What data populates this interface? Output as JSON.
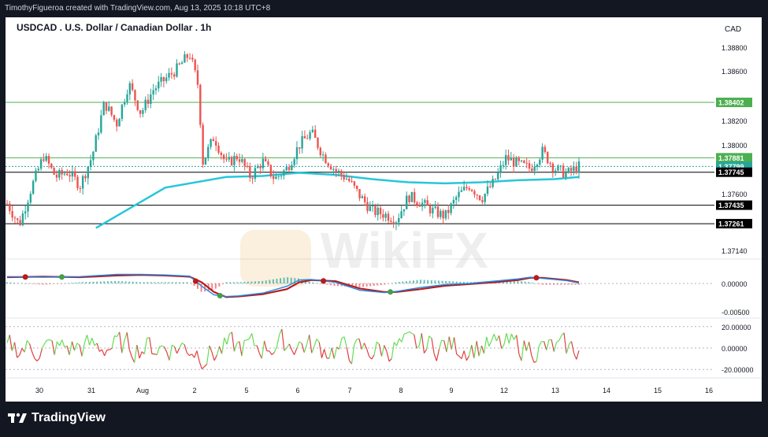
{
  "header": {
    "credit": "TimothyFigueroa created with TradingView.com, Aug 13, 2025 10:18 UTC+8"
  },
  "footer": {
    "brand": "TradingView"
  },
  "watermark": "WikiFX",
  "colors": {
    "up": "#26a69a",
    "down": "#ef5350",
    "ma": "#26c6da",
    "macd_fast": "#1e88e5",
    "macd_slow": "#b71c1c",
    "osc_up": "#66dd55",
    "osc_down": "#e04040",
    "level": "#4caf50"
  },
  "chart_data": [
    {
      "type": "candlestick",
      "title": "USDCAD . U.S. Dollar / Canadian Dollar . 1h",
      "currency": "CAD",
      "y_ticks": [
        "1.38800",
        "1.38600",
        "1.38200",
        "1.38000",
        "1.37600",
        "1.37140"
      ],
      "ylim": [
        1.3698,
        1.3898
      ],
      "x_ticks": [
        "30",
        "31",
        "Aug",
        "2",
        "5",
        "6",
        "7",
        "8",
        "9",
        "12",
        "13",
        "14",
        "15",
        "16"
      ],
      "horizontal_levels": [
        {
          "value": 1.38402,
          "label": "1.38402",
          "color": "#4caf50"
        },
        {
          "value": 1.37881,
          "label": "1.37881",
          "color": "#4caf50"
        },
        {
          "value": 1.37799,
          "label": "1.37799",
          "color": "#26a69a"
        },
        {
          "value": 1.37745,
          "label": "1.37745",
          "color": "#000000"
        },
        {
          "value": 1.37435,
          "label": "1.37435",
          "color": "#000000"
        },
        {
          "value": 1.37261,
          "label": "1.37261",
          "color": "#000000"
        }
      ],
      "series": [
        {
          "name": "price",
          "points": [
            [
              0,
              1.3745
            ],
            [
              1,
              1.3725
            ],
            [
              2,
              1.376
            ],
            [
              3,
              1.379
            ],
            [
              4,
              1.377
            ],
            [
              5,
              1.3775
            ],
            [
              6,
              1.3762
            ],
            [
              7,
              1.379
            ],
            [
              8,
              1.384
            ],
            [
              9,
              1.382
            ],
            [
              10,
              1.3858
            ],
            [
              11,
              1.383
            ],
            [
              12,
              1.3852
            ],
            [
              13,
              1.3862
            ],
            [
              14,
              1.3872
            ],
            [
              15,
              1.3886
            ],
            [
              15.8,
              1.3852
            ],
            [
              16,
              1.3782
            ],
            [
              17,
              1.3808
            ],
            [
              18,
              1.3782
            ],
            [
              19,
              1.379
            ],
            [
              20,
              1.377
            ],
            [
              21,
              1.3785
            ],
            [
              22,
              1.3768
            ],
            [
              23,
              1.3778
            ],
            [
              24,
              1.38
            ],
            [
              25,
              1.3812
            ],
            [
              26,
              1.379
            ],
            [
              27,
              1.3776
            ],
            [
              28,
              1.3768
            ],
            [
              29,
              1.3752
            ],
            [
              30,
              1.3738
            ],
            [
              31,
              1.3735
            ],
            [
              32,
              1.373
            ],
            [
              33,
              1.3752
            ],
            [
              34,
              1.3746
            ],
            [
              35,
              1.3738
            ],
            [
              36,
              1.3733
            ],
            [
              37,
              1.3752
            ],
            [
              38,
              1.3762
            ],
            [
              39,
              1.375
            ],
            [
              40,
              1.3765
            ],
            [
              41,
              1.3788
            ],
            [
              42,
              1.3782
            ],
            [
              43,
              1.3778
            ],
            [
              44,
              1.3794
            ],
            [
              45,
              1.3778
            ],
            [
              46,
              1.3773
            ],
            [
              47,
              1.378
            ]
          ]
        },
        {
          "name": "moving average",
          "points": [
            [
              7.3,
              1.3722
            ],
            [
              8.5,
              1.373
            ],
            [
              10,
              1.374
            ],
            [
              11.5,
              1.375
            ],
            [
              13,
              1.376
            ],
            [
              16,
              1.3766
            ],
            [
              18,
              1.377
            ],
            [
              21,
              1.3771
            ],
            [
              24,
              1.3774
            ],
            [
              27,
              1.3772
            ],
            [
              30,
              1.3768
            ],
            [
              33,
              1.3765
            ],
            [
              36,
              1.3764
            ],
            [
              39,
              1.3765
            ],
            [
              42,
              1.3767
            ],
            [
              45,
              1.3768
            ],
            [
              47,
              1.377
            ]
          ]
        }
      ]
    },
    {
      "type": "histogram",
      "y_ticks": [
        "0.00000",
        "-0.00500"
      ],
      "series": [
        {
          "name": "fast",
          "points": [
            [
              0,
              0.0012
            ],
            [
              3,
              0.0011
            ],
            [
              6,
              0.0012
            ],
            [
              9,
              0.0016
            ],
            [
              11,
              0.0016
            ],
            [
              13,
              0.0015
            ],
            [
              15,
              0.0013
            ],
            [
              16,
              -0.0005
            ],
            [
              17,
              -0.002
            ],
            [
              18,
              -0.0023
            ],
            [
              19,
              -0.0022
            ],
            [
              21,
              -0.0017
            ],
            [
              23,
              -0.0005
            ],
            [
              24,
              0.0006
            ],
            [
              25,
              0.0007
            ],
            [
              27,
              0.0002
            ],
            [
              29,
              -0.0012
            ],
            [
              31,
              -0.0016
            ],
            [
              32,
              -0.0014
            ],
            [
              34,
              -0.0007
            ],
            [
              36,
              -0.0002
            ],
            [
              38,
              0.0
            ],
            [
              40,
              0.0004
            ],
            [
              42,
              0.0008
            ],
            [
              43,
              0.0011
            ],
            [
              44,
              0.0009
            ],
            [
              46,
              0.0005
            ],
            [
              47,
              0.0001
            ]
          ]
        },
        {
          "name": "slow",
          "points": [
            [
              0,
              0.0011
            ],
            [
              3,
              0.0012
            ],
            [
              6,
              0.0011
            ],
            [
              9,
              0.0014
            ],
            [
              11,
              0.0015
            ],
            [
              13,
              0.0014
            ],
            [
              15,
              0.0012
            ],
            [
              16,
              0.0002
            ],
            [
              17,
              -0.0015
            ],
            [
              18,
              -0.0024
            ],
            [
              19,
              -0.0023
            ],
            [
              21,
              -0.0019
            ],
            [
              23,
              -0.001
            ],
            [
              24,
              0.0002
            ],
            [
              25,
              0.0006
            ],
            [
              27,
              0.0004
            ],
            [
              29,
              -0.0009
            ],
            [
              31,
              -0.0015
            ],
            [
              32,
              -0.0015
            ],
            [
              34,
              -0.001
            ],
            [
              36,
              -0.0004
            ],
            [
              38,
              -0.0001
            ],
            [
              40,
              0.0002
            ],
            [
              42,
              0.0006
            ],
            [
              43,
              0.001
            ],
            [
              44,
              0.001
            ],
            [
              46,
              0.0006
            ],
            [
              47,
              0.0002
            ]
          ]
        }
      ]
    },
    {
      "type": "line",
      "y_ticks": [
        "20.00000",
        "0.00000",
        "-20.00000"
      ],
      "ylim": [
        -25,
        25
      ]
    }
  ]
}
